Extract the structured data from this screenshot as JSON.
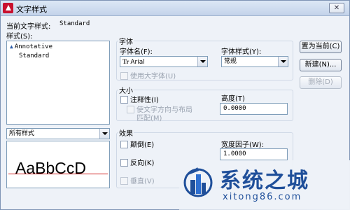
{
  "window": {
    "title": "文字样式",
    "app_icon": "autocad-icon",
    "close_icon": "close-icon",
    "close_label": "✕"
  },
  "current_style": {
    "label": "当前文字样式:",
    "value": "Standard"
  },
  "styles_panel": {
    "label": "样式(S):",
    "items": [
      {
        "label": "Annotative",
        "icon": "annotative-icon",
        "icon_glyph": "▲"
      },
      {
        "label": "Standard"
      }
    ],
    "filter_value": "所有样式"
  },
  "preview": {
    "text": "AaBbCcD"
  },
  "font_group": {
    "title": "字体",
    "font_name_label": "字体名(F):",
    "font_name_value": "Arial",
    "font_name_icon": "truetype-icon",
    "font_name_icon_glyph": "Tr",
    "font_style_label": "字体样式(Y):",
    "font_style_value": "常规",
    "big_font_label": "使用大字体(U)",
    "big_font_checked": false,
    "big_font_enabled": false
  },
  "size_group": {
    "title": "大小",
    "annotative_label": "注释性(I)",
    "annotative_checked": false,
    "match_orientation_label_1": "使文字方向与布局",
    "match_orientation_label_2": "匹配(M)",
    "match_orientation_enabled": false,
    "height_label": "高度(T)",
    "height_value": "0.0000"
  },
  "effects_group": {
    "title": "效果",
    "upside_down_label": "颠倒(E)",
    "backwards_label": "反向(K)",
    "vertical_label": "垂直(V)",
    "vertical_enabled": false,
    "width_factor_label": "宽度因子(W):",
    "width_factor_value": "1.0000"
  },
  "buttons": {
    "set_current": "置为当前(C)",
    "new": "新建(N)...",
    "delete": "删除(D)",
    "delete_enabled": false
  },
  "watermark": {
    "title": "系统之城",
    "url": "xitong86.com",
    "logo": "city-logo",
    "brand_color": "#1f4f9a"
  },
  "colors": {
    "dialog_bg": "#eef2f8",
    "titlebar": "#c3d3ea",
    "preview_baseline": "#d02020",
    "accent": "#1f4f9a"
  }
}
